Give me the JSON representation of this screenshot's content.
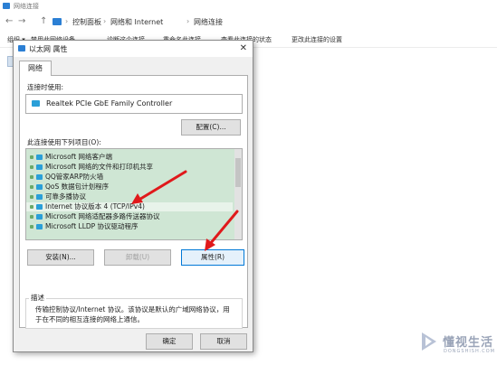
{
  "explorer": {
    "window_title": "网络连接",
    "nav": {
      "back": "←",
      "forward": "→",
      "up": "↑"
    },
    "breadcrumb": [
      "控制面板",
      "网络和 Internet",
      "网络连接"
    ],
    "breadcrumb_sep": "›",
    "toolbar": [
      "组织 ▾",
      "禁用此网络设备",
      "诊断这个连接",
      "重命名此连接",
      "查看此连接的状态",
      "更改此连接的设置"
    ]
  },
  "dialog": {
    "title": "以太网 属性",
    "close": "✕",
    "tab": "网络",
    "connect_using_label": "连接时使用:",
    "adapter_name": "Realtek PCIe GbE Family Controller",
    "configure_button": "配置(C)...",
    "items_label": "此连接使用下列项目(O):",
    "items": [
      {
        "label": "Microsoft 网络客户端"
      },
      {
        "label": "Microsoft 网络的文件和打印机共享"
      },
      {
        "label": "QQ管家ARP防火墙"
      },
      {
        "label": "QoS 数据包计划程序"
      },
      {
        "label": "可靠多播协议"
      },
      {
        "label": "Internet 协议版本 4 (TCP/IPv4)"
      },
      {
        "label": "Microsoft 网络适配器多路传送器协议"
      },
      {
        "label": "Microsoft LLDP 协议驱动程序"
      }
    ],
    "install_button": "安装(N)...",
    "uninstall_button": "卸载(U)",
    "properties_button": "属性(R)",
    "description_label": "描述",
    "description_text": "传输控制协议/Internet 协议。该协议是默认的广域网络协议，用于在不同的相互连接的网络上通信。",
    "ok_button": "确定",
    "cancel_button": "取消"
  },
  "watermark": {
    "text": "懂视生活",
    "sub": "DONGSHISH.COM"
  },
  "colors": {
    "accent": "#0078d7",
    "list_bg": "#cfe6d4",
    "arrow": "#e0191b"
  }
}
